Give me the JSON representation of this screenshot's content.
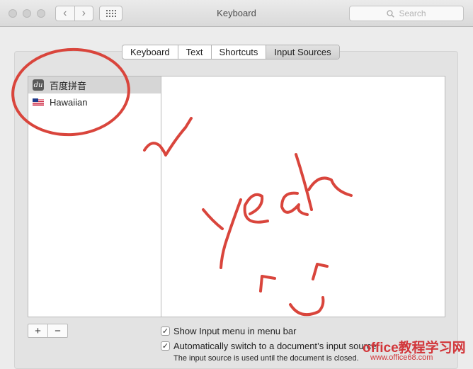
{
  "window": {
    "title": "Keyboard"
  },
  "toolbar": {
    "search_placeholder": "Search",
    "back_glyph": "‹",
    "forward_glyph": "›"
  },
  "tabs": [
    {
      "label": "Keyboard",
      "active": false
    },
    {
      "label": "Text",
      "active": false
    },
    {
      "label": "Shortcuts",
      "active": false
    },
    {
      "label": "Input Sources",
      "active": true
    }
  ],
  "input_sources": [
    {
      "label": "百度拼音",
      "icon": "du-icon",
      "icon_text": "du",
      "selected": true
    },
    {
      "label": "Hawaiian",
      "icon": "flag-icon",
      "selected": false
    }
  ],
  "controls": {
    "add_label": "+",
    "remove_label": "−"
  },
  "options": {
    "show_menu": {
      "label": "Show Input menu in menu bar",
      "checked": true
    },
    "auto_switch": {
      "label": "Automatically switch to a document’s input source",
      "checked": true
    },
    "note": "The input source is used until the document is closed."
  },
  "annotations": {
    "color": "#d9453c",
    "handwriting": "yeah"
  },
  "watermark": {
    "line1": "office教程学习网",
    "line2": "www.office68.com"
  }
}
